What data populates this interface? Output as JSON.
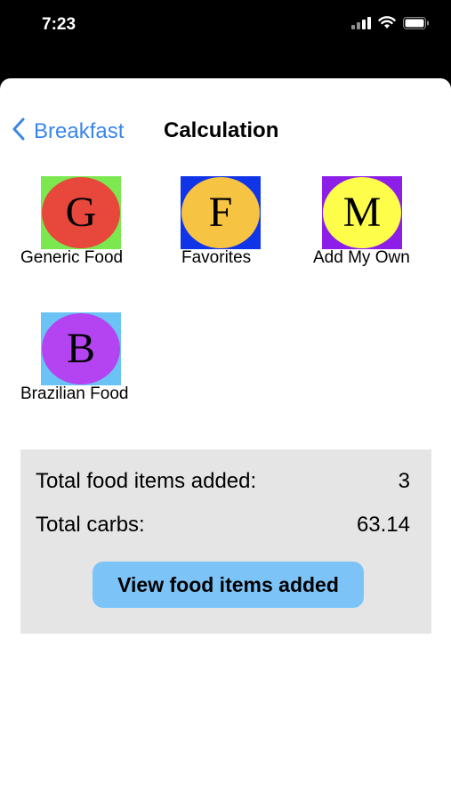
{
  "status_bar": {
    "time": "7:23"
  },
  "nav": {
    "back_label": "Breakfast",
    "title": "Calculation"
  },
  "tiles": [
    {
      "letter": "G",
      "label": "Generic Food",
      "square_color": "#7ce84f",
      "oval_color": "#e8473c"
    },
    {
      "letter": "F",
      "label": "Favorites",
      "square_color": "#1034e8",
      "oval_color": "#f6c343"
    },
    {
      "letter": "M",
      "label": "Add My Own",
      "square_color": "#8c1ee8",
      "oval_color": "#fefe4a"
    },
    {
      "letter": "B",
      "label": "Brazilian Food",
      "square_color": "#6bc3f5",
      "oval_color": "#b443f1"
    }
  ],
  "summary": {
    "items_label": "Total food items added:",
    "items_value": "3",
    "carbs_label": "Total carbs:",
    "carbs_value": "63.14",
    "button_label": "View food items added"
  },
  "colors": {
    "accent": "#3a86e8",
    "button": "#7cc4f8",
    "summary_bg": "#e5e5e5"
  }
}
